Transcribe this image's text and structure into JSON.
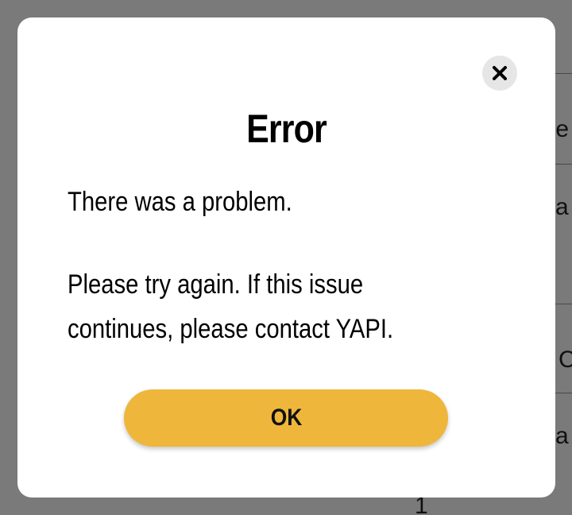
{
  "dialog": {
    "title": "Error",
    "message_line1": "There was a problem.",
    "message_line2": "Please try again. If this issue",
    "message_line3": "continues, please contact YAPI.",
    "ok_label": "OK",
    "close_icon": "close-icon",
    "accent_color": "#efb63c"
  },
  "background": {
    "fragments": [
      "ule",
      "ca",
      "e C",
      "ca",
      "1"
    ]
  }
}
